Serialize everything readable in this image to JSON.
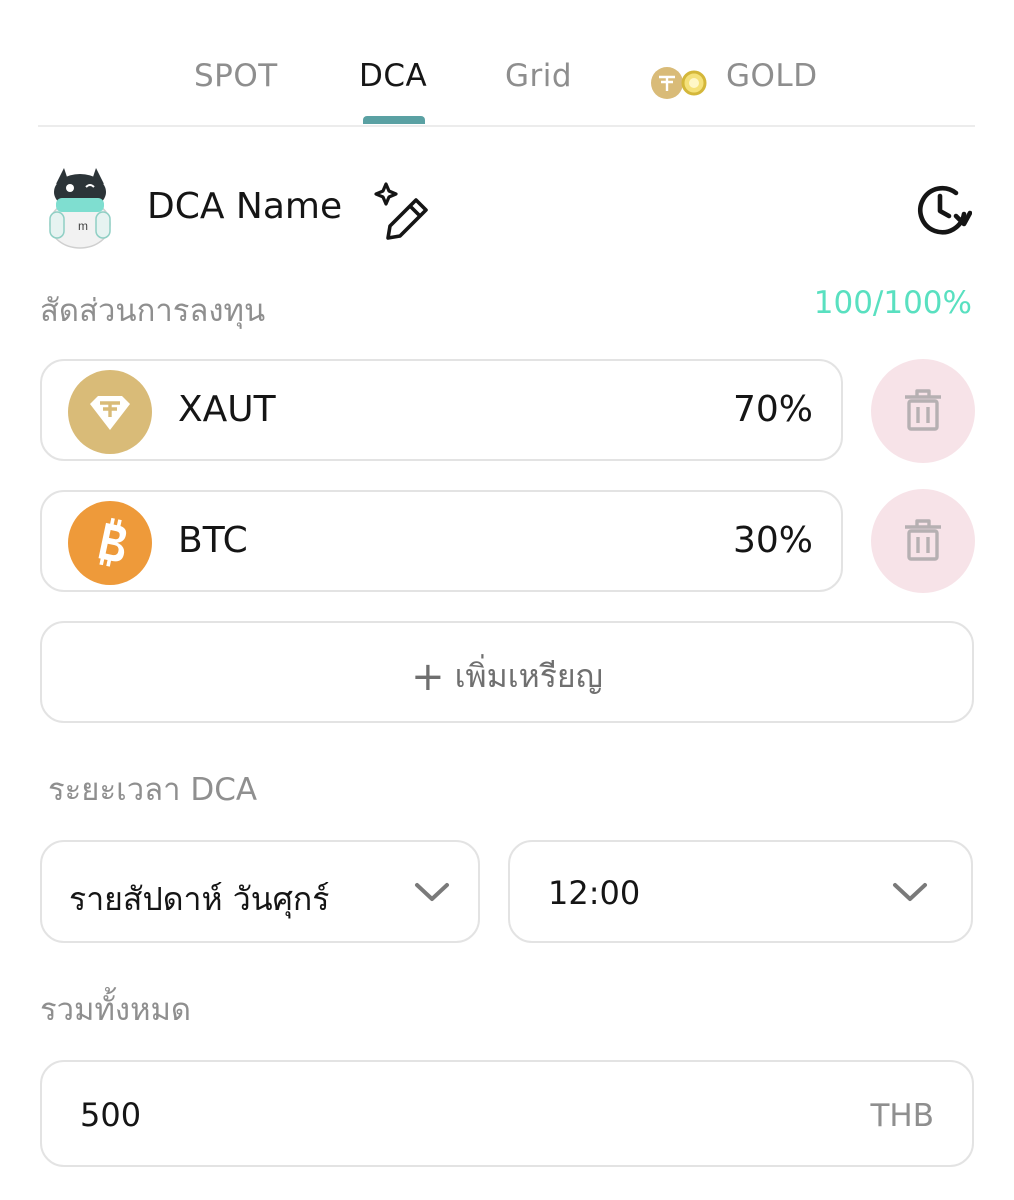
{
  "tabs": [
    {
      "label": "SPOT",
      "active": false
    },
    {
      "label": "DCA",
      "active": true
    },
    {
      "label": "Grid",
      "active": false
    },
    {
      "label": "GOLD",
      "active": false,
      "icon": "gold-coin-icon"
    }
  ],
  "header": {
    "name": "DCA Name",
    "avatar_icon": "robot-mascot-icon",
    "edit_icon": "magic-pencil-icon",
    "history_icon": "clock-history-icon"
  },
  "allocation": {
    "label": "สัดส่วนการลงทุน",
    "total": "100/100%",
    "coins": [
      {
        "symbol": "XAUT",
        "percent": "70%",
        "icon": "xaut-icon",
        "color": "#d9bb78"
      },
      {
        "symbol": "BTC",
        "percent": "30%",
        "icon": "bitcoin-icon",
        "color": "#ee9a3a"
      }
    ],
    "add_label": "เพิ่มเหรียญ"
  },
  "period": {
    "label": "ระยะเวลา DCA",
    "frequency": "รายสัปดาห์ วันศุกร์",
    "time": "12:00"
  },
  "total": {
    "label": "รวมทั้งหมด",
    "amount": "500",
    "currency": "THB"
  },
  "colors": {
    "accent": "#5aa1a3",
    "ratio": "#59e0c0",
    "delete_bg": "#f7e3e8"
  }
}
